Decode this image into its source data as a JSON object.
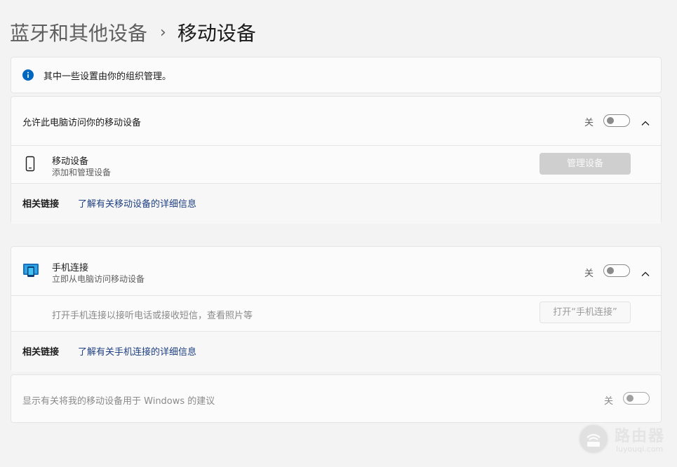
{
  "breadcrumb": {
    "parent": "蓝牙和其他设备",
    "separator": "›",
    "current": "移动设备"
  },
  "info_banner": {
    "icon": "info-icon",
    "text": "其中一些设置由你的组织管理。"
  },
  "mobile_access": {
    "title": "允许此电脑访问你的移动设备",
    "toggle_state": "关",
    "device_row": {
      "icon": "phone-icon",
      "title": "移动设备",
      "subtitle": "添加和管理设备",
      "button": "管理设备"
    },
    "related_label": "相关链接",
    "related_link": "了解有关移动设备的详细信息"
  },
  "phone_link": {
    "icon": "phone-link-app-icon",
    "title": "手机连接",
    "subtitle": "立即从电脑访问移动设备",
    "toggle_state": "关",
    "description": "打开手机连接以接听电话或接收短信，查看照片等",
    "open_button": "打开“手机连接”",
    "related_label": "相关链接",
    "related_link": "了解有关手机连接的详细信息"
  },
  "suggestions": {
    "text": "显示有关将我的移动设备用于 Windows 的建议",
    "toggle_state": "关"
  },
  "watermark": {
    "title": "路由器",
    "subtitle": "luyouqi.com"
  },
  "colors": {
    "accent": "#0067c0",
    "link": "#1d3f82",
    "background": "#f3f3f3",
    "card": "#fbfbfb"
  }
}
